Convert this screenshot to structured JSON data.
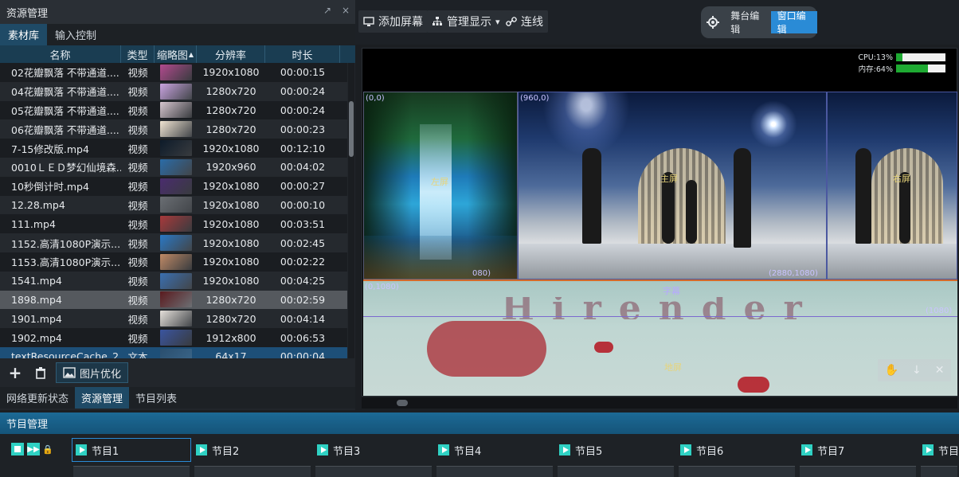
{
  "left_panel": {
    "title": "资源管理",
    "pin_icon": "pin-icon",
    "close_glyph": "×",
    "tabs": [
      {
        "label": "素材库",
        "active": true
      },
      {
        "label": "输入控制",
        "active": false
      }
    ],
    "columns": [
      "名称",
      "类型",
      "缩略图",
      "分辨率",
      "时长"
    ],
    "thumb_sort_glyph": "▲",
    "rows": [
      {
        "name": "02花瓣飘落 不带通道....",
        "type": "视频",
        "thumb_color": "#b24a8e",
        "res": "1920x1080",
        "dur": "00:00:15"
      },
      {
        "name": "04花瓣飘落 不带通道....",
        "type": "视频",
        "thumb_color": "#c9a3e0",
        "res": "1280x720",
        "dur": "00:00:24"
      },
      {
        "name": "05花瓣飘落 不带通道....",
        "type": "视频",
        "thumb_color": "#d6c6cf",
        "res": "1280x720",
        "dur": "00:00:24"
      },
      {
        "name": "06花瓣飘落 不带通道....",
        "type": "视频",
        "thumb_color": "#f0e4d2",
        "res": "1280x720",
        "dur": "00:00:23"
      },
      {
        "name": "7-15修改版.mp4",
        "type": "视频",
        "thumb_color": "#0d1b2a",
        "res": "1920x1080",
        "dur": "00:12:10"
      },
      {
        "name": "0010ＬＥＤ梦幻仙境森...",
        "type": "视频",
        "thumb_color": "#2a6ca8",
        "res": "1920x960",
        "dur": "00:04:02"
      },
      {
        "name": "10秒倒计时.mp4",
        "type": "视频",
        "thumb_color": "#4a2c6e",
        "res": "1920x1080",
        "dur": "00:00:27"
      },
      {
        "name": "12.28.mp4",
        "type": "视频",
        "thumb_color": "#6a6e73",
        "res": "1920x1080",
        "dur": "00:00:10"
      },
      {
        "name": "111.mp4",
        "type": "视频",
        "thumb_color": "#a8393b",
        "res": "1920x1080",
        "dur": "00:03:51"
      },
      {
        "name": "1152.高清1080P演示...",
        "type": "视频",
        "thumb_color": "#2a78c4",
        "res": "1920x1080",
        "dur": "00:02:45"
      },
      {
        "name": "1153.高清1080P演示...",
        "type": "视频",
        "thumb_color": "#c08a66",
        "res": "1920x1080",
        "dur": "00:02:22"
      },
      {
        "name": "1541.mp4",
        "type": "视频",
        "thumb_color": "#3a6fb0",
        "res": "1920x1080",
        "dur": "00:04:25"
      },
      {
        "name": "1898.mp4",
        "type": "视频",
        "thumb_color": "#5a1a1e",
        "res": "1280x720",
        "dur": "00:02:59",
        "selected": true
      },
      {
        "name": "1901.mp4",
        "type": "视频",
        "thumb_color": "#e5e0da",
        "res": "1280x720",
        "dur": "00:04:14"
      },
      {
        "name": "1902.mp4",
        "type": "视频",
        "thumb_color": "#3a55a0",
        "res": "1912x800",
        "dur": "00:06:53"
      },
      {
        "name": "textResourceCache_2...",
        "type": "文本",
        "thumb_color": "#2a4e6e",
        "res": "64x17",
        "dur": "00:00:04",
        "last": true
      }
    ],
    "tools": {
      "add_icon": "plus-icon",
      "delete_icon": "trash-icon",
      "optimize_label": "图片优化"
    },
    "bottom_tabs": [
      {
        "label": "网络更新状态",
        "active": false
      },
      {
        "label": "资源管理",
        "active": true
      },
      {
        "label": "节目列表",
        "active": false
      }
    ]
  },
  "toolbar": {
    "add_screen": "添加屏幕",
    "manage_display": "管理显示",
    "connect": "连线",
    "dropdown_glyph": "▾",
    "mode_stage": "舞台编辑",
    "mode_window": "窗口编辑"
  },
  "preview": {
    "cpu_label": "CPU:13%",
    "cpu_value": 0.13,
    "mem_label": "内存:64%",
    "mem_value": 0.64,
    "coord_origin": "(0,0)",
    "coord_960": "(960,0)",
    "coord_1080": "(0,1080)",
    "coord_2880": "(2880,1080)",
    "coord_cut": "080)",
    "coord_right": "(1080)",
    "left_screen_label": "左屏",
    "mid_screen_label": "主屏",
    "right_screen_label": "右屏",
    "bottom_screen_label": "地屏",
    "bottom_title": "字幕",
    "banner_text": "Hirender"
  },
  "programs": {
    "title": "节目管理",
    "items": [
      "节目1",
      "节目2",
      "节目3",
      "节目4",
      "节目5",
      "节目6",
      "节目7",
      "节目"
    ],
    "active_index": 0
  },
  "colors": {
    "accent": "#2a8bd6",
    "selection": "#55595e",
    "play": "#2fd1c3"
  }
}
